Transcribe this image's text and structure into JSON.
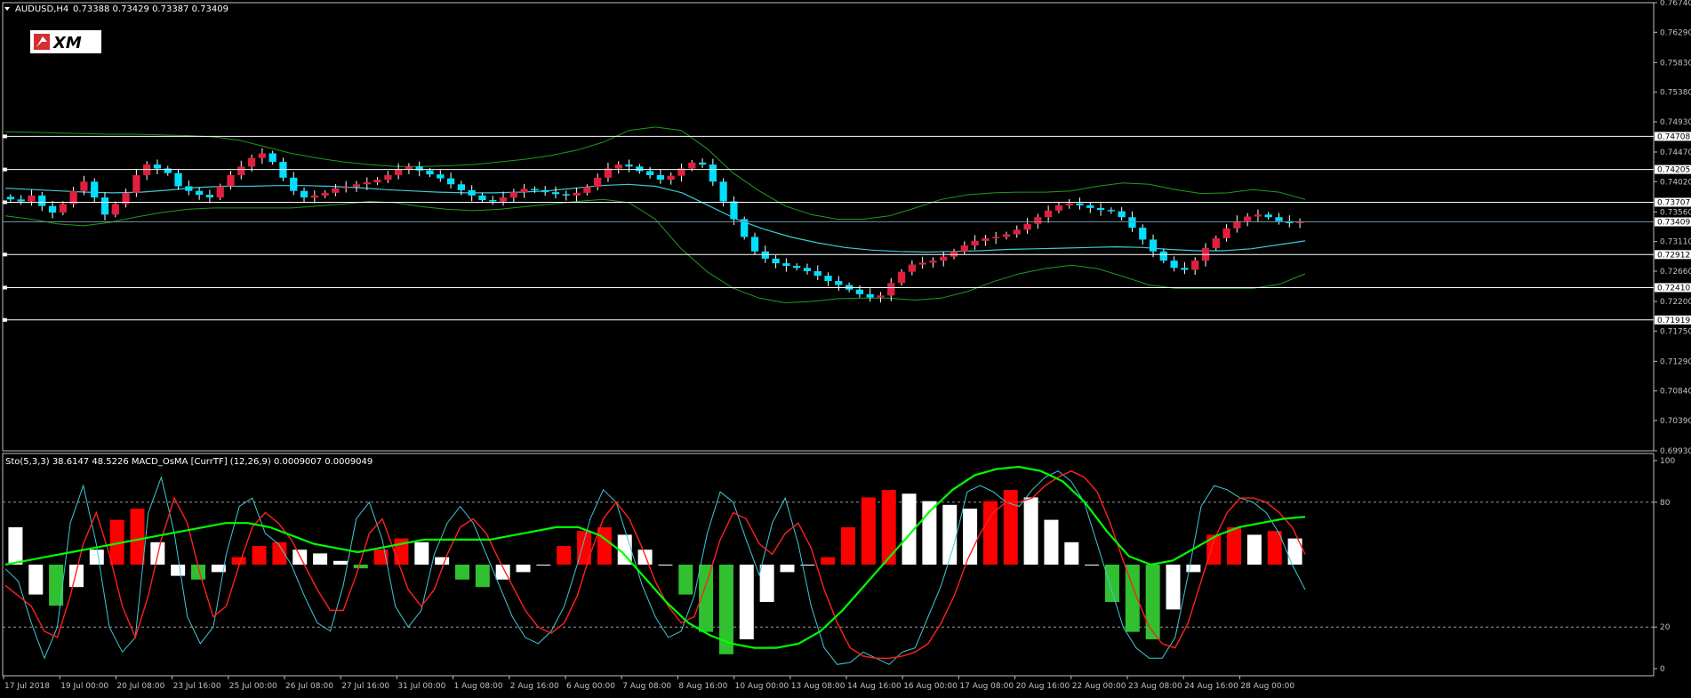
{
  "header": {
    "symbol": "AUDUSD,H4",
    "ohlc": "0.73388 0.73429 0.73387 0.73409"
  },
  "logo": {
    "text": "XM"
  },
  "indicator_header": {
    "text": "Sto(5,3,3) 38.6147 48.5226  MACD_OsMA [CurrTF] (12,26,9) 0.0009007 0.0009049"
  },
  "colors": {
    "background": "#000000",
    "axis": "#c0c0c0",
    "bull": "#e0203e",
    "bear": "#00e0ff",
    "ma": "#3ec9d8",
    "bands": "#1f9b1f",
    "sr_line": "#ffffff",
    "stoch_main": "#3ec9d8",
    "stoch_signal": "#ff2020",
    "macd_signal": "#00ff00",
    "osma_up": "#ff0000",
    "osma_down": "#30c030",
    "osma_fade": "#ffffff"
  },
  "chart_data": [
    {
      "type": "candlestick",
      "title": "AUDUSD,H4",
      "ylim": [
        0.6993,
        0.7674
      ],
      "y_ticks": [
        "0.76740",
        "0.76290",
        "0.75830",
        "0.75380",
        "0.74930",
        "0.74470",
        "0.74020",
        "0.73560",
        "0.73110",
        "0.72660",
        "0.72200",
        "0.71750",
        "0.71290",
        "0.70840",
        "0.70390",
        "0.69930"
      ],
      "x_tick_labels": [
        "17 Jul 2018",
        "19 Jul 00:00",
        "20 Jul 08:00",
        "23 Jul 16:00",
        "25 Jul 00:00",
        "26 Jul 08:00",
        "27 Jul 16:00",
        "31 Jul 00:00",
        "1 Aug 08:00",
        "2 Aug 16:00",
        "6 Aug 00:00",
        "7 Aug 08:00",
        "8 Aug 16:00",
        "10 Aug 00:00",
        "13 Aug 08:00",
        "14 Aug 16:00",
        "16 Aug 00:00",
        "17 Aug 08:00",
        "20 Aug 16:00",
        "22 Aug 00:00",
        "23 Aug 08:00",
        "24 Aug 16:00",
        "28 Aug 00:00"
      ],
      "support_resistance": [
        0.74708,
        0.74205,
        0.73707,
        0.72912,
        0.7241,
        0.71919
      ],
      "level_labels": [
        "0.74708",
        "0.74205",
        "0.73707",
        "0.72912",
        "0.72410",
        "0.71919"
      ],
      "last_price": 0.73409,
      "last_price_label": "0.73409",
      "close_path": [
        0.7375,
        0.7372,
        0.7381,
        0.7365,
        0.7355,
        0.7368,
        0.7388,
        0.7402,
        0.7378,
        0.7352,
        0.7368,
        0.7385,
        0.7412,
        0.7428,
        0.7422,
        0.7415,
        0.7395,
        0.7388,
        0.7382,
        0.7378,
        0.7395,
        0.7412,
        0.7425,
        0.7438,
        0.7445,
        0.7432,
        0.7408,
        0.7388,
        0.7378,
        0.7381,
        0.7385,
        0.7392,
        0.7394,
        0.7398,
        0.7401,
        0.7405,
        0.7412,
        0.7421,
        0.7425,
        0.7419,
        0.7413,
        0.7407,
        0.7398,
        0.7389,
        0.7381,
        0.7374,
        0.7372,
        0.7378,
        0.7386,
        0.7391,
        0.7389,
        0.7386,
        0.7383,
        0.7381,
        0.7385,
        0.7394,
        0.7408,
        0.7422,
        0.7428,
        0.7425,
        0.7418,
        0.7412,
        0.7405,
        0.7411,
        0.7422,
        0.7431,
        0.7428,
        0.7402,
        0.7372,
        0.7345,
        0.7318,
        0.7296,
        0.7285,
        0.7278,
        0.7274,
        0.7271,
        0.7266,
        0.7259,
        0.7251,
        0.7245,
        0.7238,
        0.7231,
        0.7226,
        0.7229,
        0.7248,
        0.7265,
        0.7276,
        0.7279,
        0.7282,
        0.7288,
        0.7296,
        0.7305,
        0.7312,
        0.7316,
        0.7318,
        0.7322,
        0.7329,
        0.7338,
        0.7348,
        0.7358,
        0.7366,
        0.7369,
        0.7366,
        0.7362,
        0.7359,
        0.7357,
        0.7348,
        0.7332,
        0.7314,
        0.7296,
        0.7282,
        0.7271,
        0.7268,
        0.7282,
        0.7301,
        0.7316,
        0.7331,
        0.7342,
        0.7349,
        0.7352,
        0.7348,
        0.7342,
        0.7339,
        0.7341
      ],
      "ma_path": [
        0.7392,
        0.739,
        0.7388,
        0.7386,
        0.7385,
        0.7386,
        0.7389,
        0.7393,
        0.7395,
        0.7395,
        0.7396,
        0.7396,
        0.7395,
        0.7393,
        0.739,
        0.7388,
        0.7386,
        0.7385,
        0.7385,
        0.7386,
        0.7388,
        0.7392,
        0.7396,
        0.7398,
        0.7395,
        0.7385,
        0.7365,
        0.7345,
        0.733,
        0.7318,
        0.7309,
        0.7302,
        0.7298,
        0.7296,
        0.7295,
        0.7296,
        0.7297,
        0.7299,
        0.73,
        0.7301,
        0.7302,
        0.7303,
        0.7302,
        0.7299,
        0.7297,
        0.7297,
        0.73,
        0.7306,
        0.7312
      ],
      "upper_band_path": [
        0.7478,
        0.7477,
        0.7476,
        0.7475,
        0.7474,
        0.7474,
        0.7473,
        0.7472,
        0.747,
        0.7465,
        0.7455,
        0.7445,
        0.7438,
        0.7432,
        0.7428,
        0.7425,
        0.7425,
        0.7426,
        0.7428,
        0.7432,
        0.7436,
        0.7442,
        0.745,
        0.7462,
        0.748,
        0.7485,
        0.748,
        0.7452,
        0.7415,
        0.7388,
        0.7365,
        0.7352,
        0.7345,
        0.7345,
        0.735,
        0.7362,
        0.7375,
        0.7382,
        0.7385,
        0.7386,
        0.7386,
        0.7388,
        0.7395,
        0.74,
        0.7398,
        0.739,
        0.7384,
        0.7385,
        0.739,
        0.7386,
        0.7375
      ],
      "lower_band_path": [
        0.735,
        0.7345,
        0.7338,
        0.7335,
        0.734,
        0.7348,
        0.7355,
        0.736,
        0.7362,
        0.7362,
        0.7362,
        0.7362,
        0.7365,
        0.7368,
        0.7372,
        0.737,
        0.7364,
        0.736,
        0.7358,
        0.736,
        0.7364,
        0.7368,
        0.7372,
        0.7375,
        0.737,
        0.7345,
        0.73,
        0.7265,
        0.724,
        0.7225,
        0.7218,
        0.722,
        0.7224,
        0.7225,
        0.7225,
        0.7222,
        0.7225,
        0.7235,
        0.725,
        0.7262,
        0.727,
        0.7275,
        0.727,
        0.7258,
        0.7245,
        0.724,
        0.724,
        0.724,
        0.724,
        0.7246,
        0.7262
      ]
    },
    {
      "type": "line",
      "title": "Sto(5,3,3) / MACD_OsMA [CurrTF] (12,26,9)",
      "ylim": [
        0,
        100
      ],
      "y_ticks": [
        "100",
        "80",
        "20",
        "0"
      ],
      "levels": [
        80,
        20
      ],
      "series": [
        {
          "name": "Sto main",
          "values": [
            48,
            42,
            22,
            5,
            20,
            70,
            88,
            60,
            20,
            8,
            15,
            75,
            92,
            65,
            25,
            12,
            20,
            55,
            78,
            82,
            65,
            60,
            50,
            35,
            22,
            18,
            40,
            72,
            80,
            62,
            30,
            20,
            28,
            55,
            70,
            78,
            70,
            55,
            40,
            25,
            15,
            12,
            18,
            30,
            50,
            72,
            86,
            80,
            60,
            40,
            25,
            15,
            18,
            35,
            65,
            85,
            80,
            62,
            45,
            70,
            82,
            60,
            30,
            10,
            2,
            3,
            8,
            5,
            2,
            8,
            10,
            25,
            40,
            60,
            85,
            88,
            85,
            80,
            78,
            86,
            92,
            95,
            90,
            80,
            60,
            40,
            20,
            10,
            5,
            5,
            15,
            45,
            78,
            88,
            86,
            82,
            80,
            75,
            65,
            50,
            38
          ]
        },
        {
          "name": "Sto signal",
          "values": [
            40,
            35,
            30,
            18,
            15,
            35,
            60,
            75,
            55,
            30,
            15,
            35,
            62,
            82,
            70,
            45,
            25,
            30,
            50,
            68,
            75,
            70,
            62,
            50,
            38,
            28,
            28,
            45,
            65,
            72,
            55,
            38,
            30,
            38,
            55,
            68,
            72,
            65,
            52,
            40,
            28,
            20,
            17,
            22,
            35,
            55,
            72,
            80,
            72,
            58,
            42,
            30,
            22,
            25,
            42,
            62,
            75,
            72,
            60,
            55,
            65,
            70,
            58,
            38,
            22,
            10,
            6,
            5,
            5,
            6,
            8,
            12,
            22,
            35,
            52,
            65,
            75,
            80,
            80,
            82,
            88,
            92,
            95,
            92,
            85,
            70,
            52,
            35,
            20,
            12,
            10,
            22,
            42,
            62,
            75,
            82,
            82,
            80,
            75,
            68,
            55
          ]
        },
        {
          "name": "MACD signal",
          "values": [
            50,
            52,
            54,
            56,
            58,
            60,
            62,
            64,
            66,
            68,
            70,
            70,
            68,
            64,
            60,
            58,
            56,
            58,
            60,
            62,
            62,
            62,
            62,
            64,
            66,
            68,
            68,
            64,
            56,
            44,
            32,
            22,
            16,
            12,
            10,
            10,
            12,
            18,
            28,
            40,
            52,
            64,
            76,
            86,
            93,
            96,
            97,
            95,
            90,
            80,
            66,
            54,
            50,
            52,
            58,
            64,
            68,
            70,
            72,
            73
          ]
        }
      ],
      "osma_histogram": [
        1.0,
        -0.8,
        -1.1,
        -0.6,
        0.4,
        1.2,
        1.5,
        0.6,
        -0.3,
        -0.4,
        -0.2,
        0.2,
        0.5,
        0.6,
        0.4,
        0.3,
        0.1,
        -0.1,
        0.4,
        0.7,
        0.6,
        0.2,
        -0.4,
        -0.6,
        -0.4,
        -0.2,
        0.0,
        0.5,
        0.9,
        1.0,
        0.8,
        0.4,
        0.0,
        -0.8,
        -1.8,
        -2.4,
        -2.0,
        -1.0,
        -0.2,
        0.0,
        0.2,
        1.0,
        1.8,
        2.0,
        1.9,
        1.7,
        1.6,
        1.5,
        1.7,
        2.0,
        1.8,
        1.2,
        0.6,
        0.0,
        -1.0,
        -1.8,
        -2.0,
        -1.2,
        -0.2,
        0.8,
        1.0,
        0.8,
        0.9,
        0.7
      ]
    }
  ]
}
